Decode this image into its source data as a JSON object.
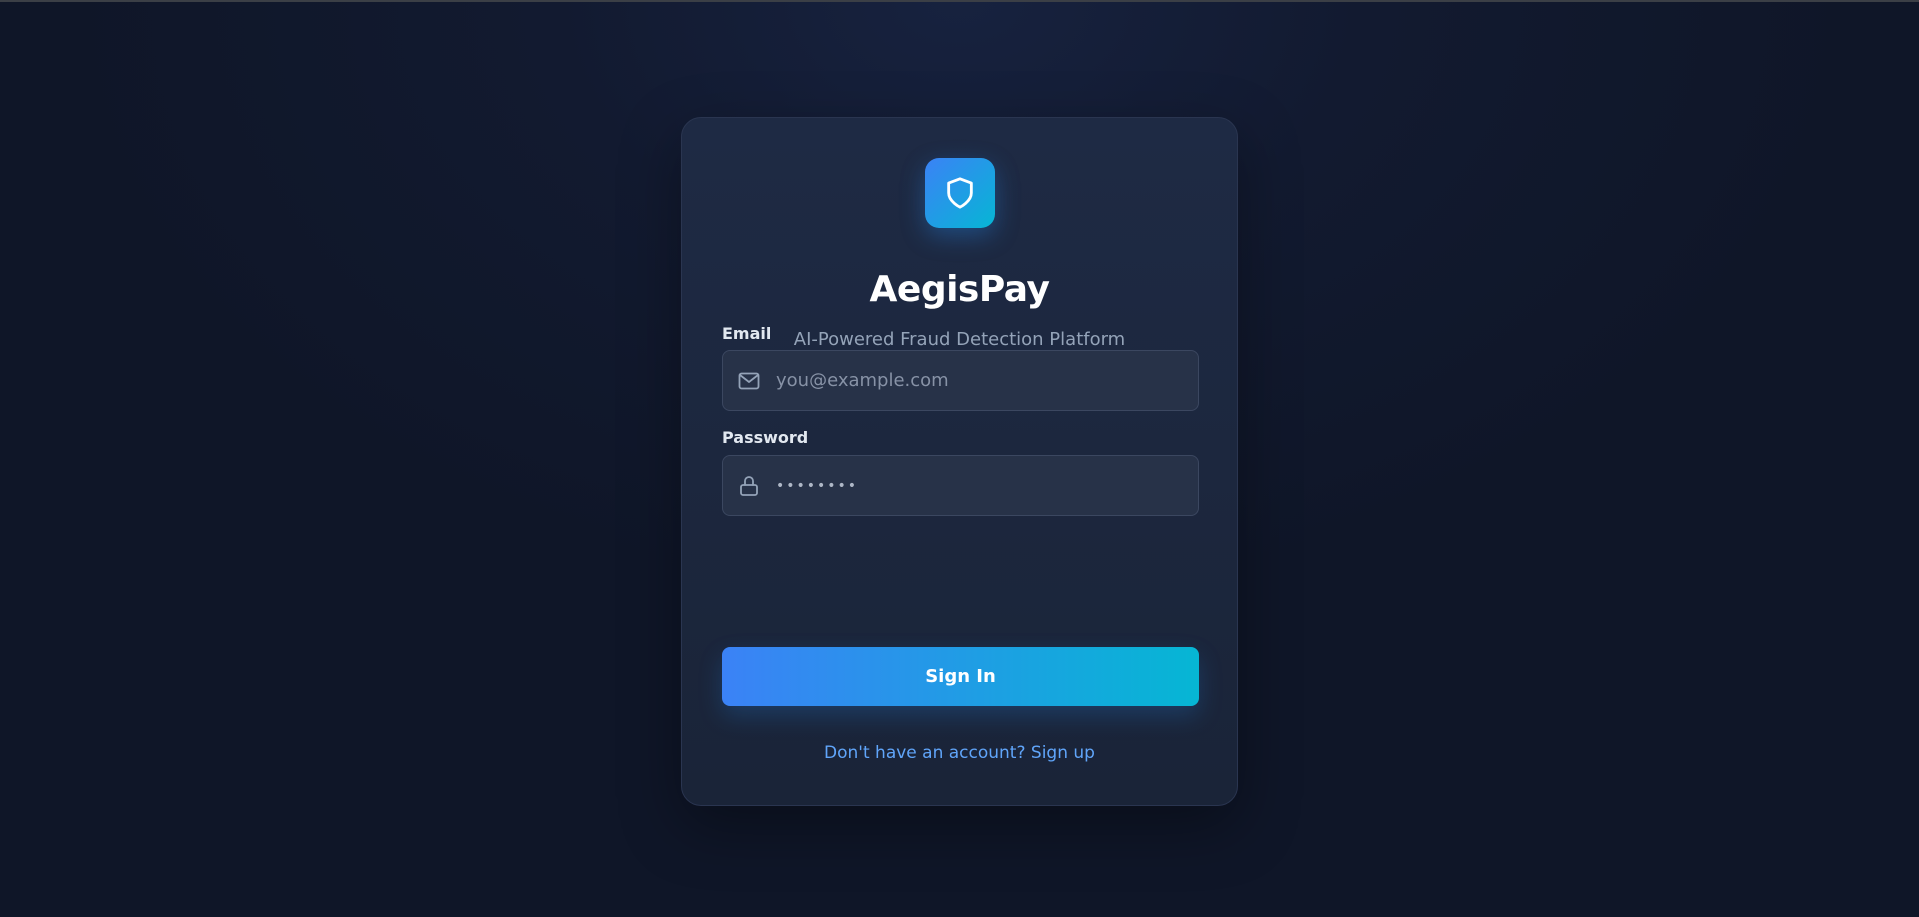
{
  "brand": {
    "name": "AegisPay",
    "tagline": "AI-Powered Fraud Detection Platform",
    "logo_icon": "shield-icon",
    "gradient_start": "#3b82f6",
    "gradient_end": "#06b6d4"
  },
  "form": {
    "email": {
      "label": "Email",
      "placeholder": "you@example.com",
      "value": "",
      "icon": "mail-icon"
    },
    "password": {
      "label": "Password",
      "value": "••••••••",
      "icon": "lock-icon"
    },
    "submit_label": "Sign In",
    "signup_link": "Don't have an account? Sign up"
  },
  "colors": {
    "background": "#121a30",
    "card": "#1e2a44",
    "link": "#60a5fa"
  }
}
